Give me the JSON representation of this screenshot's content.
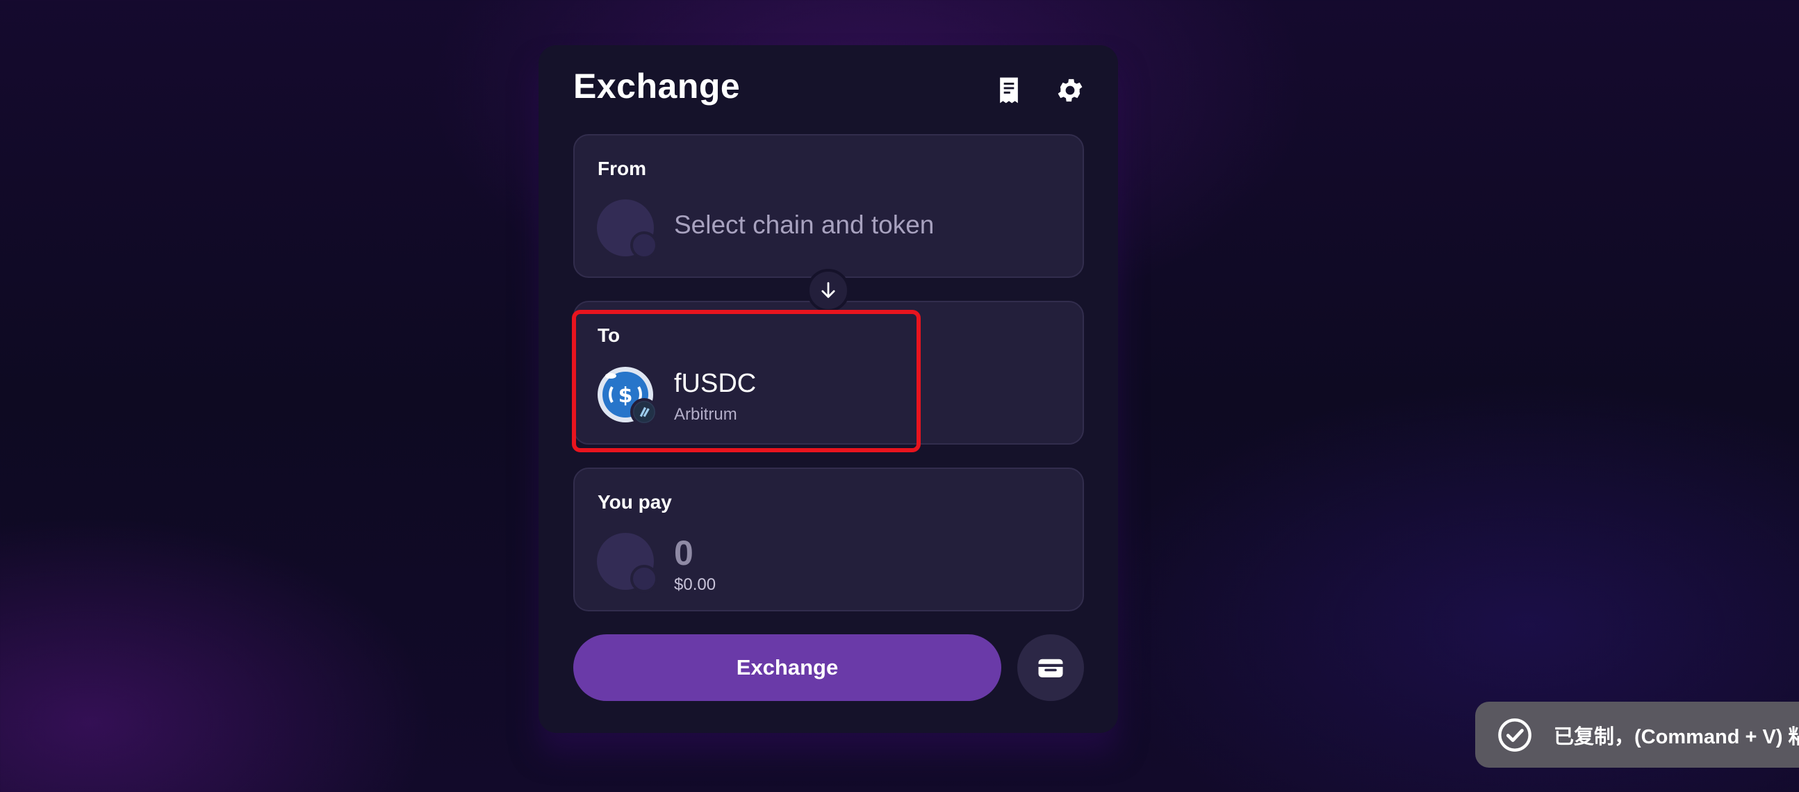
{
  "card": {
    "title": "Exchange",
    "icons": {
      "history": "receipt-icon",
      "settings": "gear-icon"
    }
  },
  "from": {
    "label": "From",
    "placeholder": "Select chain and token"
  },
  "to": {
    "label": "To",
    "token": "fUSDC",
    "chain": "Arbitrum",
    "token_icon": "usdc-token-icon",
    "chain_icon": "arbitrum-chain-icon"
  },
  "pay": {
    "label": "You pay",
    "amount": "0",
    "usd_value": "$0.00"
  },
  "actions": {
    "exchange_label": "Exchange",
    "wallet_icon": "wallet-icon",
    "swap_icon": "arrow-down-icon"
  },
  "toast": {
    "text": "已复制，(Command + V) 粘",
    "icon": "check-circle-icon"
  },
  "colors": {
    "accent": "#6a3aa8",
    "panel": "#231f3b",
    "card": "#15122a",
    "highlight": "#e8141e",
    "usdc": "#2775ca"
  }
}
